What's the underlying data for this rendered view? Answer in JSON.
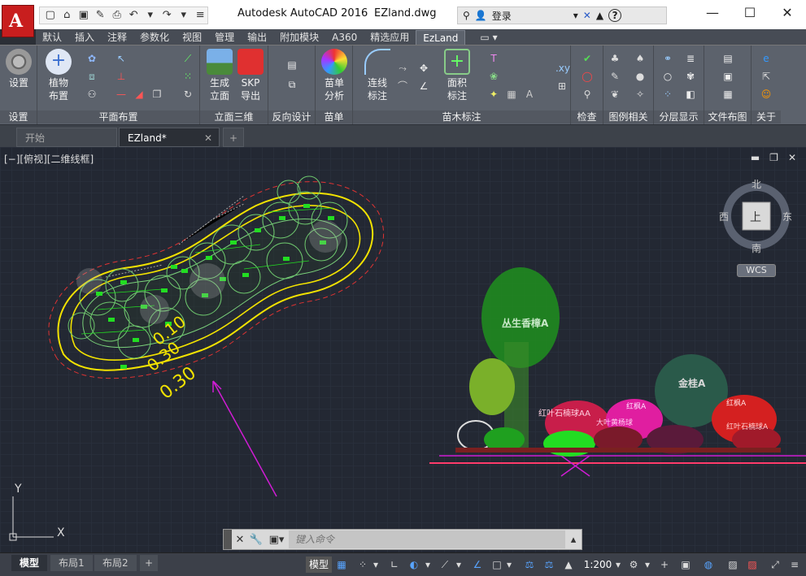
{
  "window": {
    "app_title": "Autodesk AutoCAD 2016",
    "file_title": "EZland.dwg",
    "login": "登录",
    "help": "?"
  },
  "menu_tabs": [
    "默认",
    "插入",
    "注释",
    "参数化",
    "视图",
    "管理",
    "输出",
    "附加模块",
    "A360",
    "精选应用",
    "EzLand"
  ],
  "active_tab": "EzLand",
  "ribbon": {
    "panels": {
      "settings": "设置",
      "plan": "平面布置",
      "elevation": "立面三维",
      "reverse": "反向设计",
      "nursery": "苗单",
      "nursery_label": "苗木标注",
      "check": "检查",
      "legend": "图例相关",
      "layers": "分层显示",
      "layout": "文件布图",
      "about": "关于"
    },
    "buttons": {
      "settings": "设置",
      "plant_line1": "植物",
      "plant_line2": "布置",
      "gen_line1": "生成",
      "gen_line2": "立面",
      "skp_line1": "SKP",
      "skp_line2": "导出",
      "nursery_line1": "苗单",
      "nursery_line2": "分析",
      "connect_line1": "连线",
      "connect_line2": "标注",
      "area_line1": "面积",
      "area_line2": "标注"
    },
    "xy_label": ".xy"
  },
  "doc_tabs": {
    "start": "开始",
    "file": "EZland*"
  },
  "viewport": {
    "label": "[−][俯视][二维线框]",
    "compass": {
      "north": "北",
      "south": "南",
      "east": "东",
      "west": "西",
      "top": "上"
    },
    "wcs": "WCS"
  },
  "drawing": {
    "slope_labels": [
      "0.10",
      "0.30",
      "0.30"
    ],
    "elev_labels": [
      "丛生香樟A",
      "金桂A",
      "红叶石楠球AA",
      "大叶黄杨球",
      "红叶石楠球A",
      "红枫A",
      "红枫A"
    ]
  },
  "ucs": {
    "x": "X",
    "y": "Y"
  },
  "command": {
    "placeholder": "键入命令"
  },
  "status": {
    "layouts": [
      "模型",
      "布局1",
      "布局2"
    ],
    "model": "模型",
    "scale": "1:200"
  },
  "colors": {
    "ribbon": "#5c626c",
    "canvas": "#232833",
    "accent": "#c81e1e",
    "plant_green": "#22dd22",
    "contour_yellow": "#f2e200",
    "magenta": "#d01cd4"
  }
}
